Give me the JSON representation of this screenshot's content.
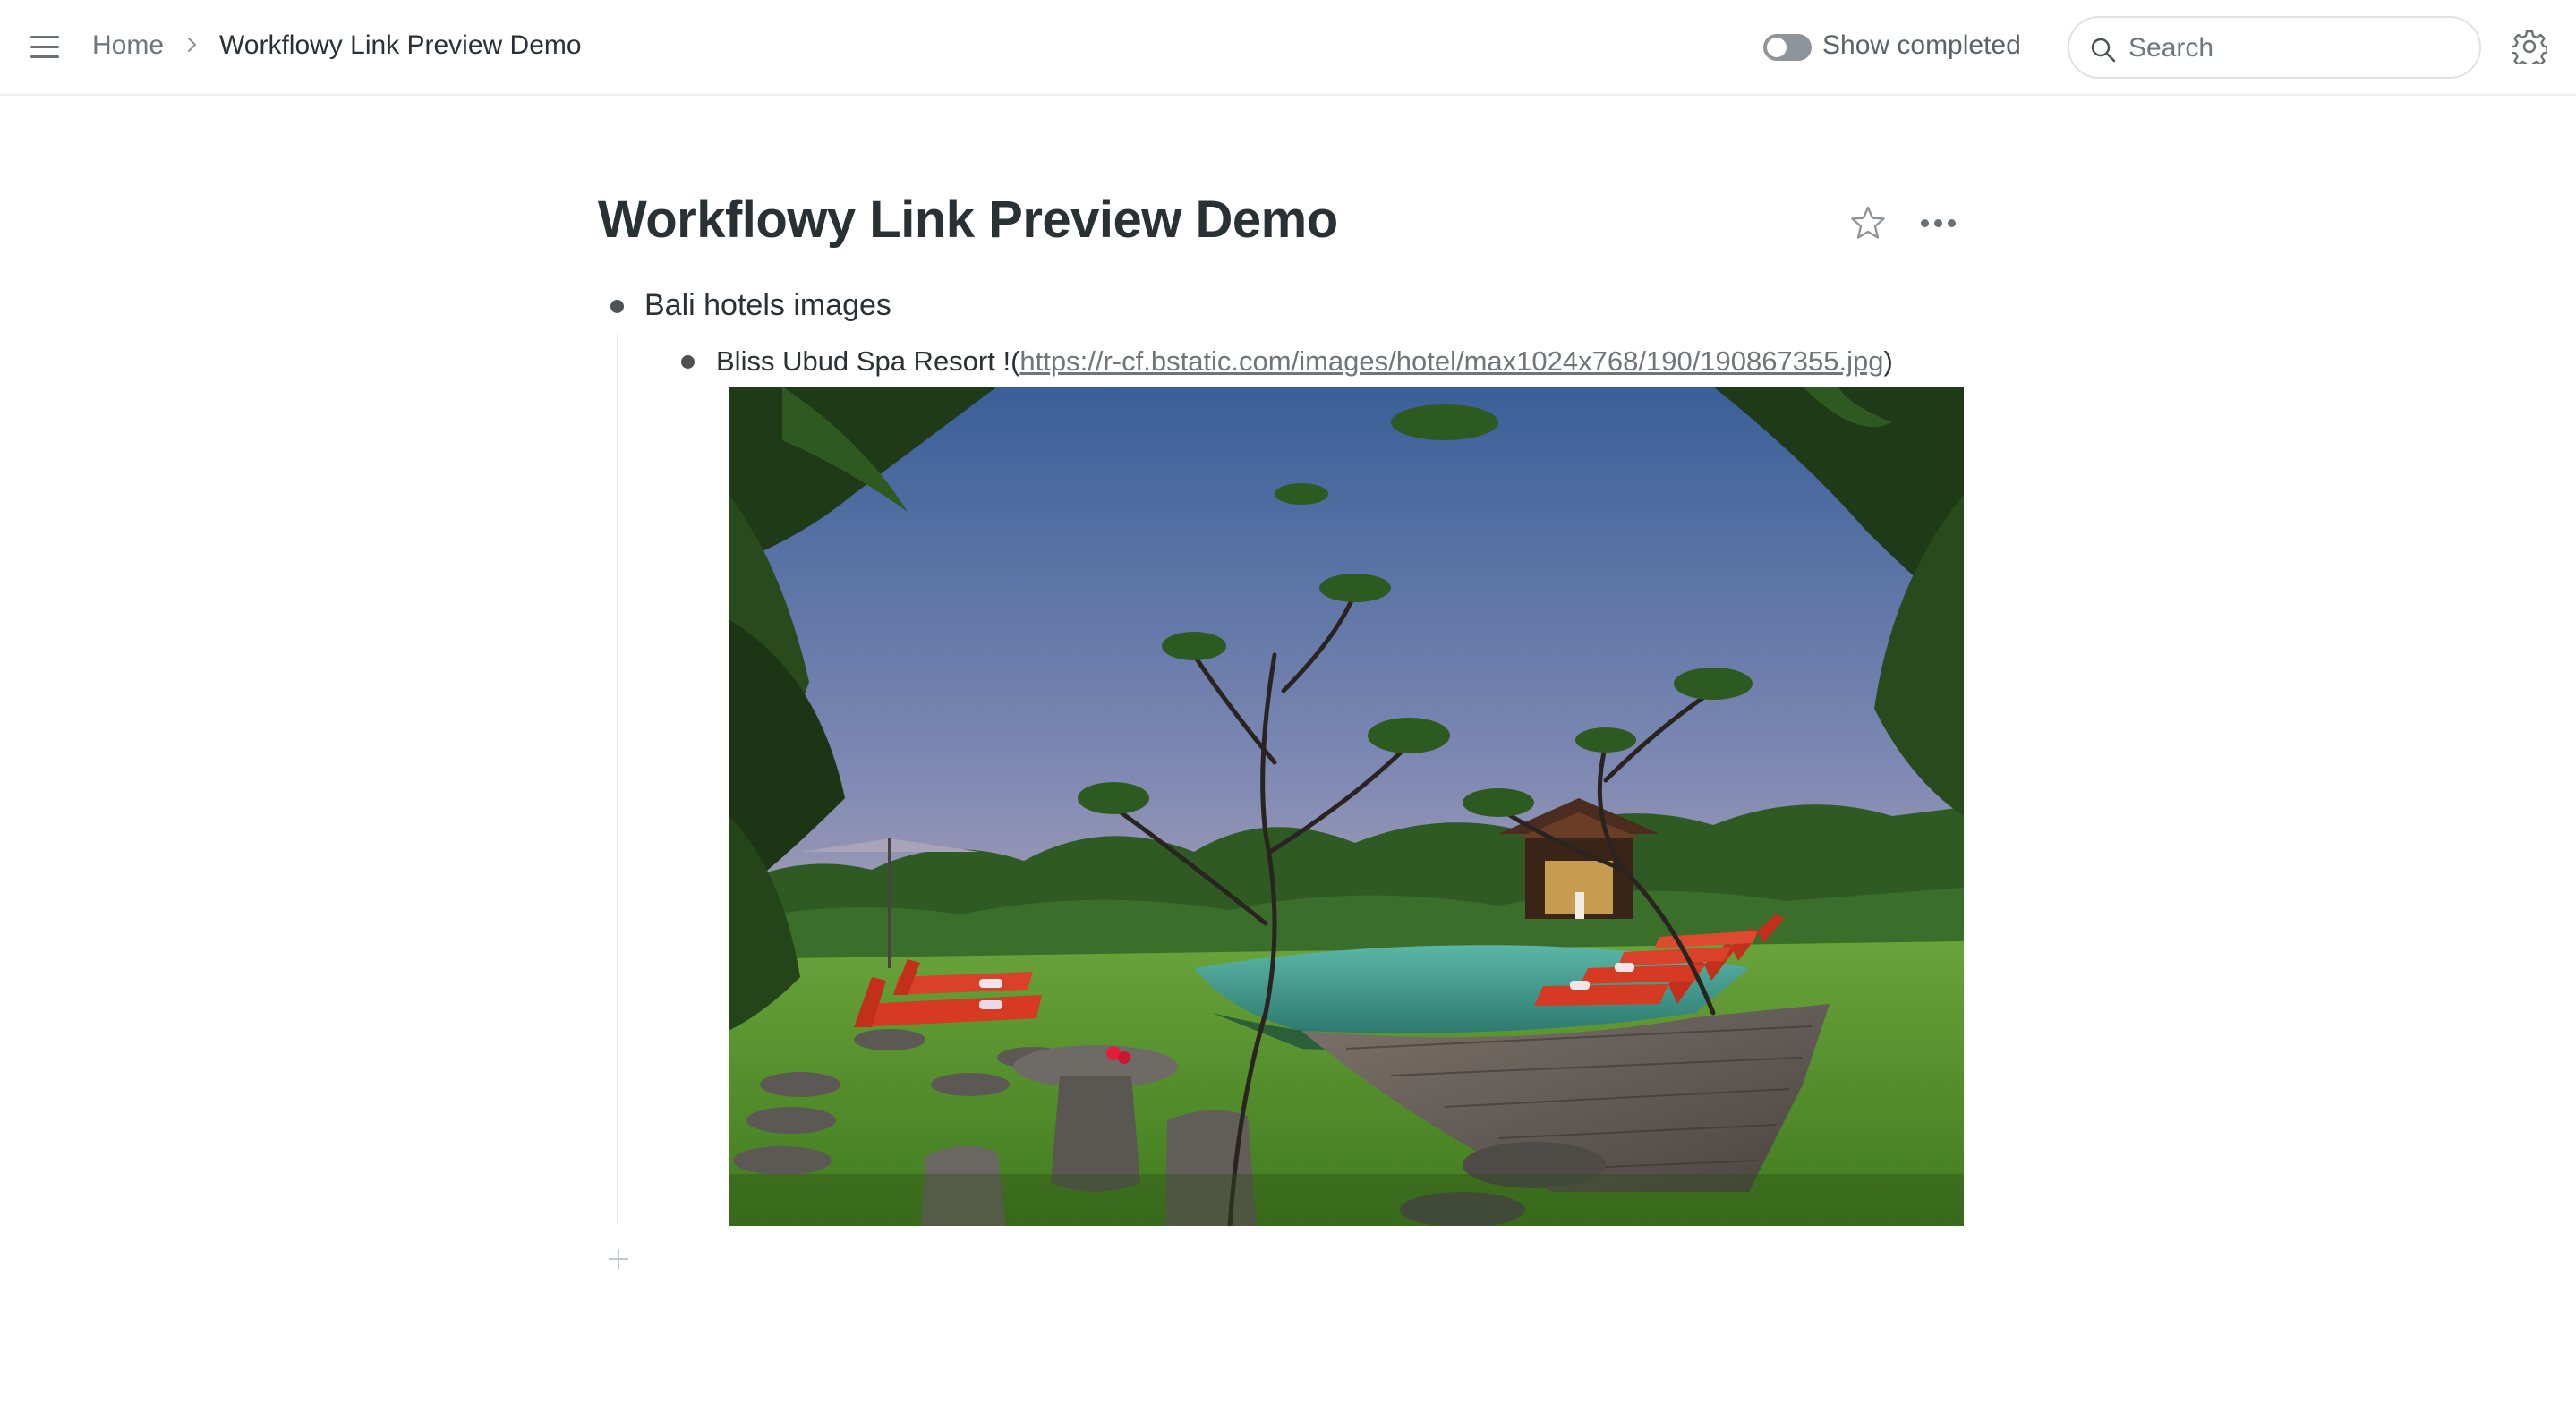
{
  "topbar": {
    "breadcrumb": {
      "home_label": "Home",
      "current_label": "Workflowy Link Preview Demo"
    },
    "show_completed_label": "Show completed",
    "show_completed_on": false,
    "search": {
      "placeholder": "Search",
      "value": ""
    },
    "icons": [
      "menu-icon",
      "chevron-right-icon",
      "search-icon",
      "gear-icon"
    ]
  },
  "page": {
    "title": "Workflowy Link Preview Demo",
    "icons": [
      "star-icon",
      "more-icon",
      "add-icon"
    ]
  },
  "outline": {
    "items": [
      {
        "text": "Bali hotels images",
        "children": [
          {
            "prefix": "Bliss Ubud Spa Resort !(",
            "link": "https://r-cf.bstatic.com/images/hotel/max1024x768/190/190867355.jpg",
            "suffix": ")",
            "image_alt": "Resort pool with red sun loungers, tropical garden and trees at dusk"
          }
        ]
      }
    ]
  },
  "colors": {
    "text": "#2a3135",
    "muted": "#6f757a",
    "bullet": "#4b5155",
    "border": "#eceef0",
    "toggle_off": "#8e9499",
    "lounger_red": "#d63a22",
    "pool": "#3d9a8c",
    "grass": "#5a9a2a"
  }
}
